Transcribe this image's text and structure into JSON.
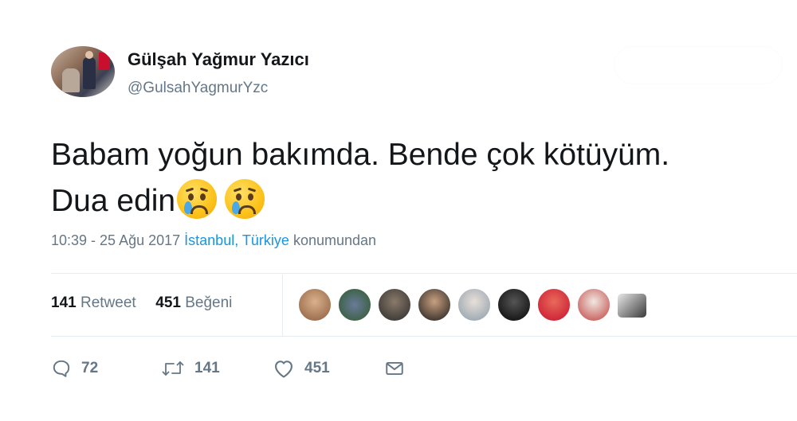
{
  "author": {
    "name": "Gülşah Yağmur Yazıcı",
    "handle": "@GulsahYagmurYzc"
  },
  "tweet": {
    "line1": "Babam yoğun bakımda. Bende çok kötüyüm.",
    "line2": "Dua edin",
    "emojis": [
      "crying-face-emoji",
      "crying-face-emoji"
    ]
  },
  "meta": {
    "time": "10:39 - 25 Ağu 2017",
    "city": "İstanbul",
    "comma": ",",
    "country": "Türkiye",
    "suffix": "konumundan"
  },
  "stats": {
    "retweet_count": "141",
    "retweet_label": "Retweet",
    "like_count": "451",
    "like_label": "Beğeni"
  },
  "likers": [
    "avatar-1",
    "avatar-2",
    "avatar-3",
    "avatar-4",
    "avatar-5",
    "avatar-6",
    "avatar-7",
    "avatar-8",
    "avatar-9"
  ],
  "actions": {
    "reply_count": "72",
    "retweet_count": "141",
    "like_count": "451"
  },
  "colors": {
    "text": "#14171a",
    "secondary": "#657786",
    "link": "#1b95e0",
    "divider": "#e6ecf0"
  }
}
